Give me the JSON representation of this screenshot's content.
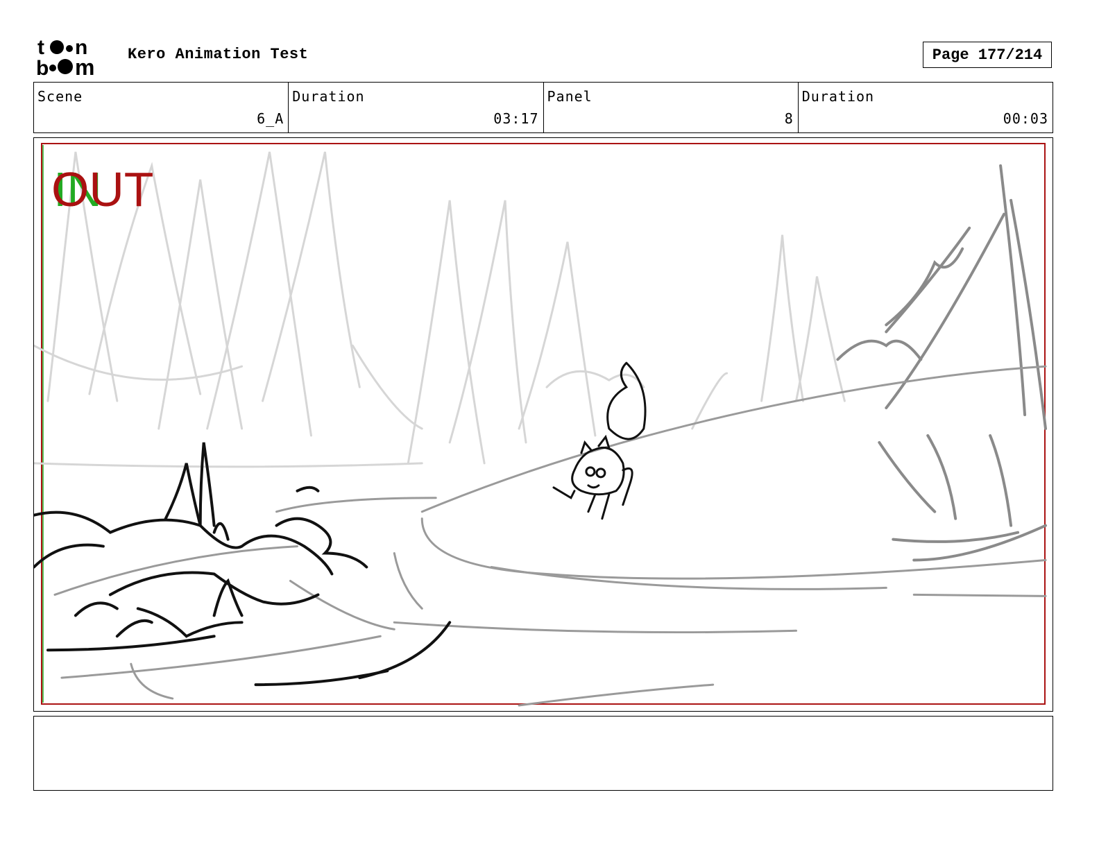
{
  "header": {
    "logo_text_top": "toon",
    "logo_text_bottom": "boom",
    "title": "Kero Animation Test",
    "page": "Page 177/214"
  },
  "info": {
    "scene_label": "Scene",
    "scene_value": "6_A",
    "duration_label": "Duration",
    "duration_value": "03:17",
    "panel_label": "Panel",
    "panel_value": "8",
    "panel_duration_label": "Duration",
    "panel_duration_value": "00:03"
  },
  "panel": {
    "in_marker": "IN",
    "out_marker": "OUT",
    "in_color": "#22aa22",
    "out_color": "#aa1111"
  },
  "notes": {
    "text": ""
  }
}
